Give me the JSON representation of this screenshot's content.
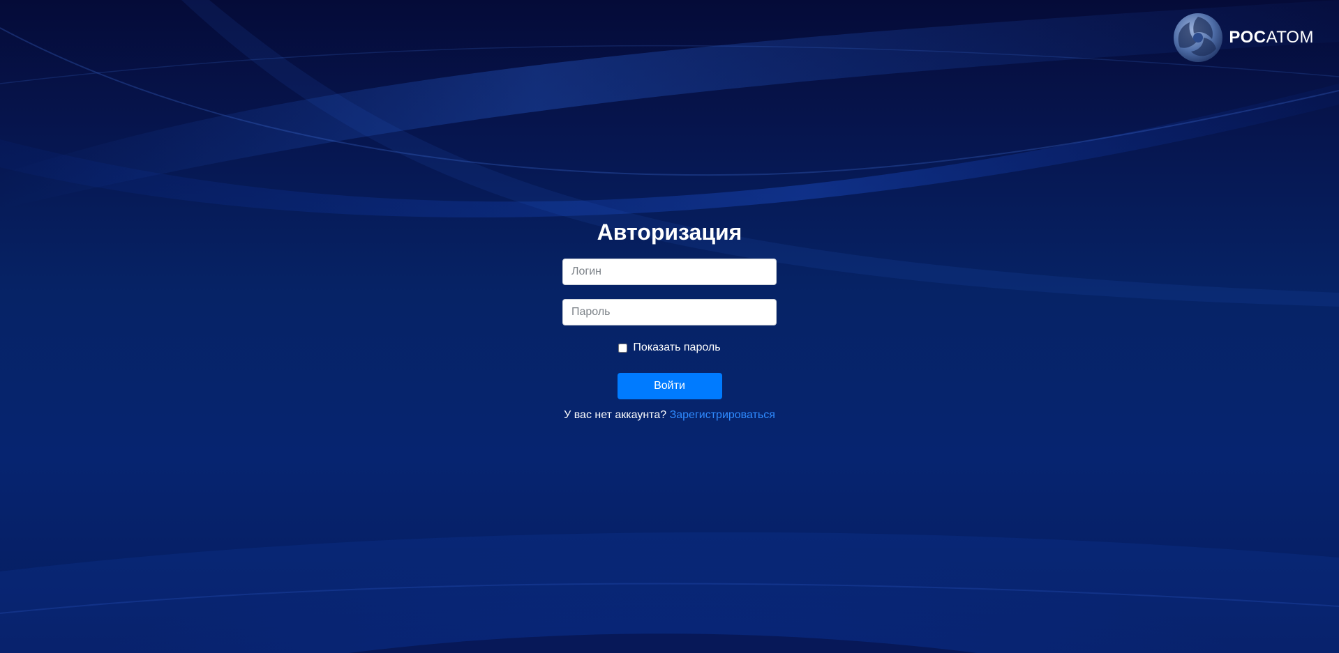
{
  "brand": {
    "logo_text_bold": "РОС",
    "logo_text_thin": "АТОМ"
  },
  "login_form": {
    "title": "Авторизация",
    "login_placeholder": "Логин",
    "password_placeholder": "Пароль",
    "show_password_label": "Показать пароль",
    "submit_label": "Войти",
    "no_account_text": "У вас нет аккаунта?",
    "register_link": "Зарегистрироваться"
  },
  "colors": {
    "background_dark": "#050b38",
    "background_mid": "#062366",
    "primary_button": "#007bff",
    "link": "#2f8bff"
  }
}
